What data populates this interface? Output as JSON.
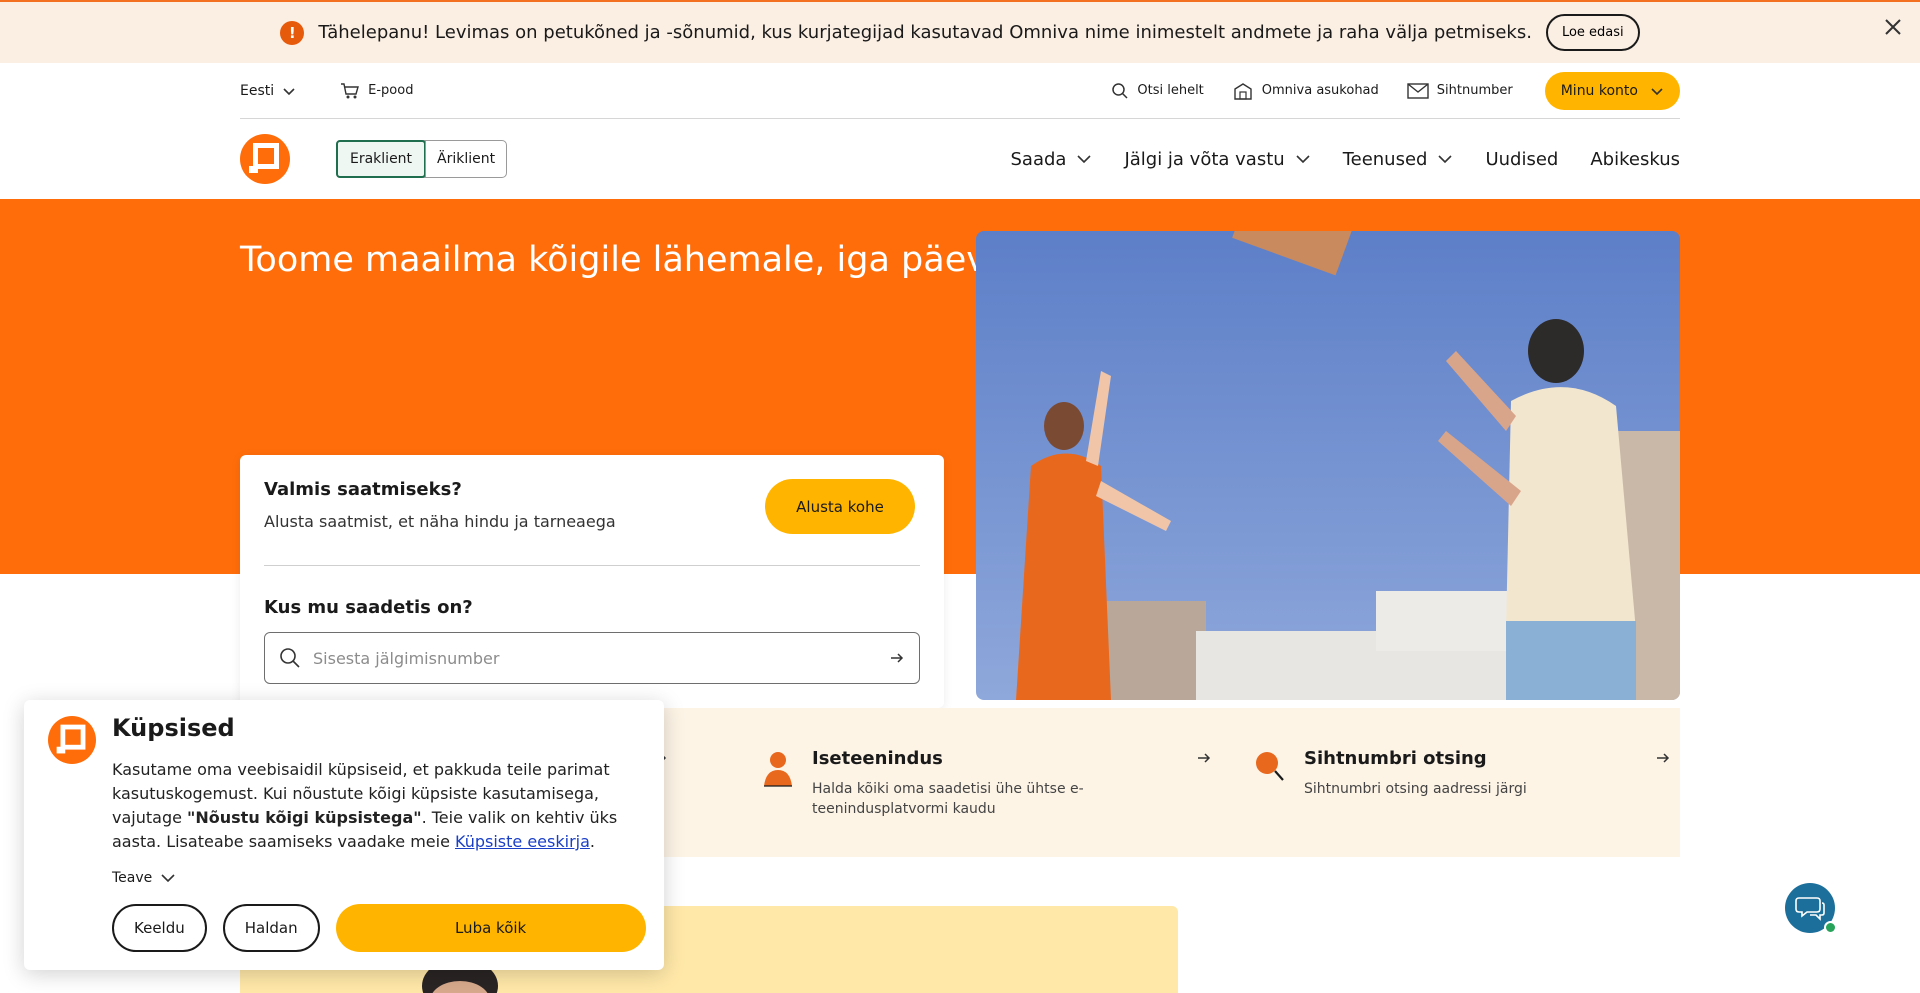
{
  "alert": {
    "icon": "exclamation-icon",
    "text": "Tähelepanu! Levimas on petukõned ja -sõnumid, kus kurjategijad kasutavad Omniva nime inimestelt andmete ja raha välja petmiseks.",
    "button": "Loe edasi",
    "close_icon": "close-icon"
  },
  "utility": {
    "language": "Eesti",
    "eshop": "E-pood",
    "search": "Otsi lehelt",
    "locations": "Omniva asukohad",
    "postcode": "Sihtnumber",
    "account": "Minu konto"
  },
  "nav": {
    "segments": [
      "Eraklient",
      "Äriklient"
    ],
    "links": [
      {
        "label": "Saada",
        "dropdown": true
      },
      {
        "label": "Jälgi ja võta vastu",
        "dropdown": true
      },
      {
        "label": "Teenused",
        "dropdown": true
      },
      {
        "label": "Uudised",
        "dropdown": false
      },
      {
        "label": "Abikeskus",
        "dropdown": false
      }
    ]
  },
  "hero": {
    "title": "Toome maailma kõigile lähemale, iga päev"
  },
  "card": {
    "ready_title": "Valmis saatmiseks?",
    "ready_sub": "Alusta saatmist, et näha hindu ja tarneaega",
    "start_button": "Alusta kohe",
    "track_title": "Kus mu saadetis on?",
    "track_placeholder": "Sisesta jälgimisnumber"
  },
  "services": [
    {
      "icon": "person-icon",
      "title": "Iseteenindus",
      "desc": "Halda kõiki oma saadetisi ühe ühtse e-teenindusplatvormi kaudu"
    },
    {
      "icon": "magnifier-icon",
      "title": "Sihtnumbri otsing",
      "desc": "Sihtnumbri otsing aadressi järgi"
    }
  ],
  "cookie": {
    "title": "Küpsised",
    "body_1": "Kasutame oma veebisaidil küpsiseid, et pakkuda teile parimat kasutuskogemust. Kui nõustute kõigi küpsiste kasutamisega, vajutage ",
    "body_bold": "\"Nõustu kõigi küpsistega\"",
    "body_2": ". Teie valik on kehtiv üks aasta. Lisateabe saamiseks vaadake meie ",
    "link": "Küpsiste eeskirja",
    "body_3": ".",
    "info": "Teave",
    "decline": "Keeldu",
    "manage": "Haldan",
    "accept_all": "Luba kõik"
  },
  "colors": {
    "brand_orange": "#ff6d0a",
    "accent_yellow": "#ffb500",
    "services_bg": "#fdf4e6",
    "chat_blue": "#1d6f9b"
  }
}
